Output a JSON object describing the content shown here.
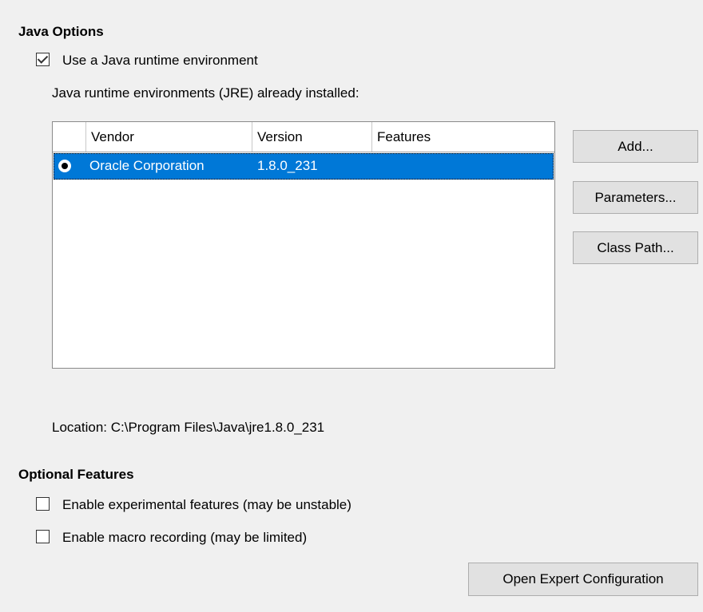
{
  "java_options": {
    "title": "Java Options",
    "use_jre_label": "Use a Java runtime environment",
    "use_jre_checked": true,
    "installed_label": "Java runtime environments (JRE) already installed:",
    "table": {
      "columns": [
        "Vendor",
        "Version",
        "Features"
      ],
      "rows": [
        {
          "vendor": "Oracle Corporation",
          "version": "1.8.0_231",
          "features": "",
          "selected": true
        }
      ]
    },
    "buttons": {
      "add": "Add...",
      "parameters": "Parameters...",
      "class_path": "Class Path..."
    },
    "location": "Location: C:\\Program Files\\Java\\jre1.8.0_231"
  },
  "optional_features": {
    "title": "Optional Features",
    "experimental_label": "Enable experimental features (may be unstable)",
    "experimental_checked": false,
    "macro_label": "Enable macro recording (may be limited)",
    "macro_checked": false
  },
  "expert_button": "Open Expert Configuration",
  "colors": {
    "selection": "#0078d7",
    "background": "#f0f0f0",
    "button": "#e1e1e1"
  }
}
